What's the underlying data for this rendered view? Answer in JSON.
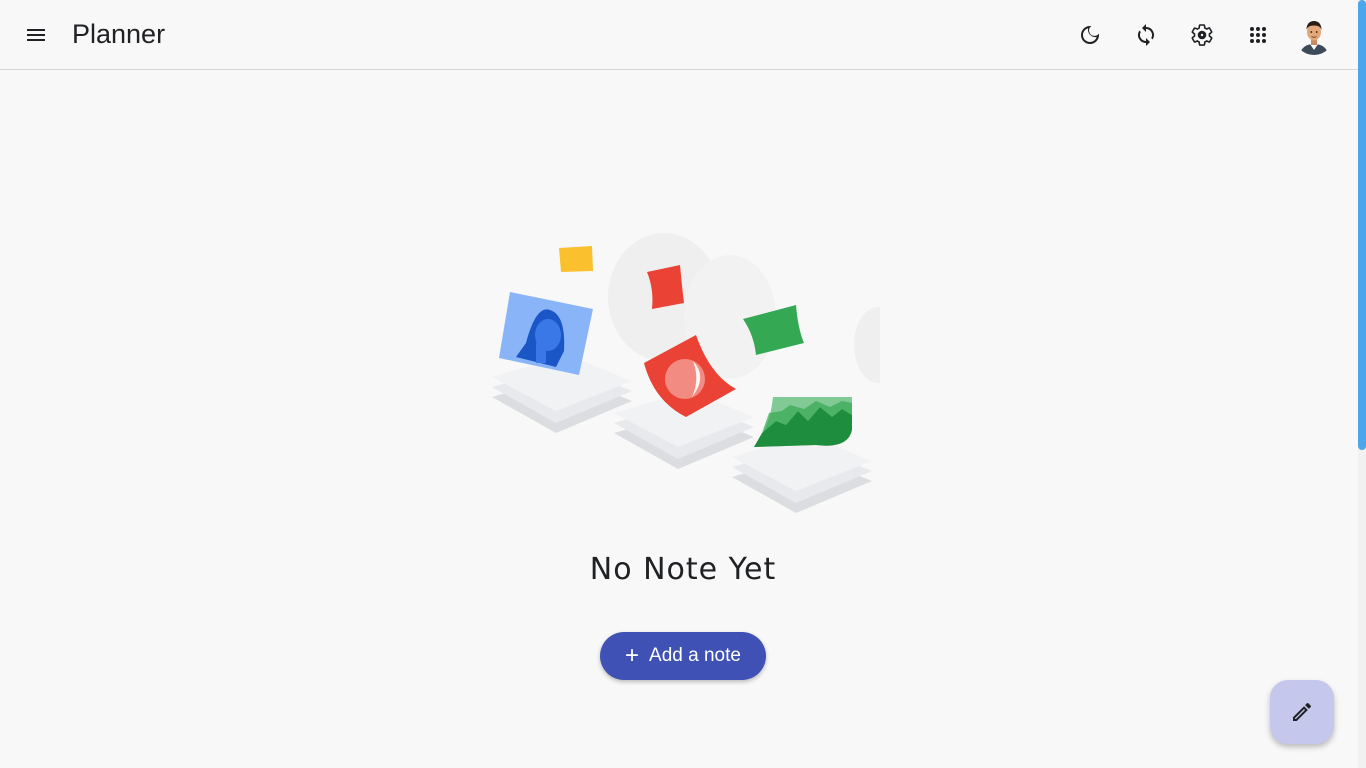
{
  "app": {
    "title": "Planner"
  },
  "header": {
    "icons": [
      "menu-icon",
      "moon-icon",
      "sync-icon",
      "gear-icon",
      "apps-grid-icon",
      "avatar"
    ]
  },
  "empty_state": {
    "title": "No Note Yet",
    "button_label": "Add a note",
    "button_icon": "plus-icon"
  },
  "fab": {
    "icon": "pencil-icon"
  },
  "colors": {
    "primary": "#3f51b5",
    "fab": "#c5c8ec",
    "scroll_thumb": "#4da6ea",
    "background": "#f8f8f8"
  }
}
